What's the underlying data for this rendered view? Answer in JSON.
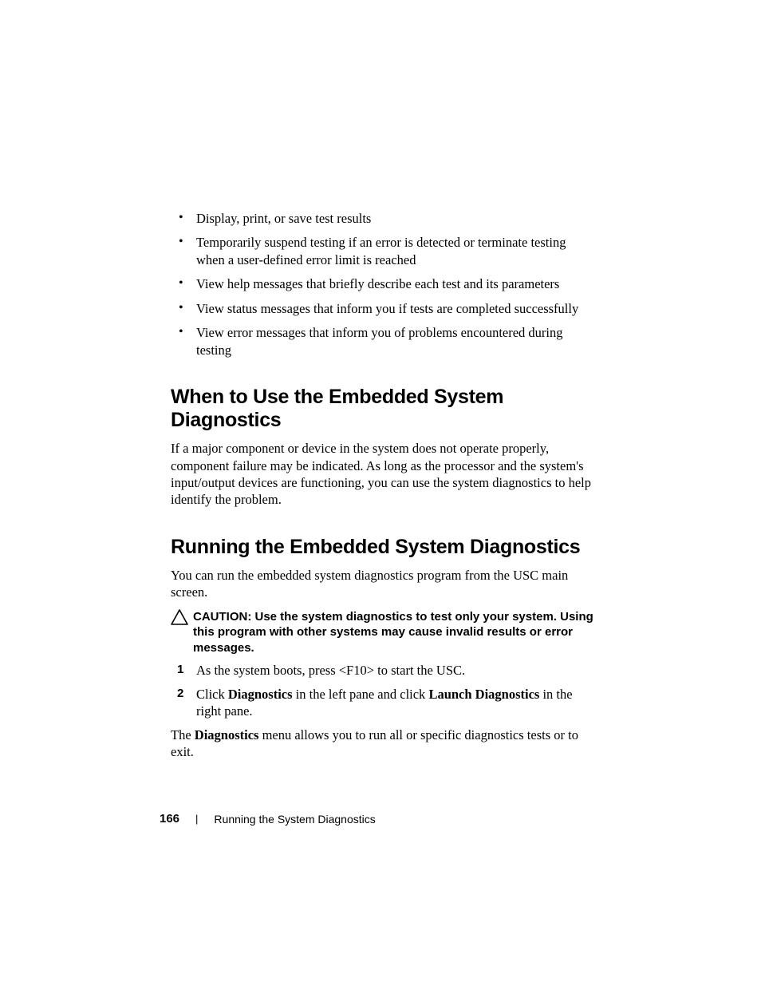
{
  "bullets": [
    "Display, print, or save test results",
    "Temporarily suspend testing if an error is detected or terminate testing when a user-defined error limit is reached",
    "View help messages that briefly describe each test and its parameters",
    "View status messages that inform you if tests are completed successfully",
    "View error messages that inform you of problems encountered during testing"
  ],
  "section1": {
    "heading": "When to Use the Embedded System Diagnostics",
    "para": "If a major component or device in the system does not operate properly, component failure may be indicated. As long as the processor and the system's input/output devices are functioning, you can use the system diagnostics to help identify the problem."
  },
  "section2": {
    "heading": "Running the Embedded System Diagnostics",
    "intro": "You can run the embedded system diagnostics program from the USC main screen.",
    "caution_label": "CAUTION: ",
    "caution_text": "Use the system diagnostics to test only your system. Using this program with other systems may cause invalid results or error messages.",
    "steps": {
      "s1": {
        "num": "1",
        "text": "As the system boots, press <F10> to start the USC."
      },
      "s2": {
        "num": "2",
        "pre": "Click ",
        "b1": "Diagnostics",
        "mid": " in the left pane and click ",
        "b2": "Launch Diagnostics",
        "post": " in the right pane."
      }
    },
    "closing_pre": "The ",
    "closing_b": "Diagnostics",
    "closing_post": " menu allows you to run all or specific diagnostics tests or to exit."
  },
  "footer": {
    "page": "166",
    "divider": "|",
    "title": "Running the System Diagnostics"
  }
}
